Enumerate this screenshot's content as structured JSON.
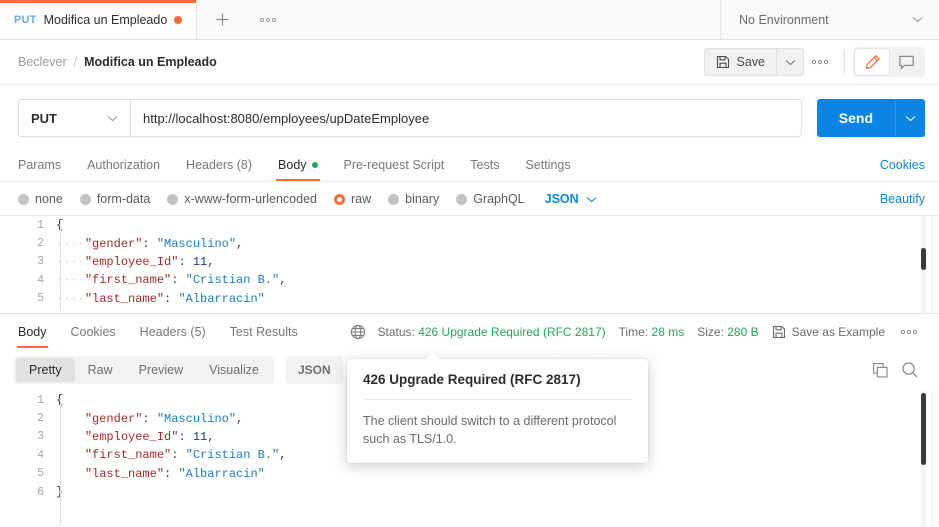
{
  "tabbar": {
    "request_tab": {
      "method": "PUT",
      "title": "Modifica un Empleado",
      "unsaved": true
    },
    "new_tab_label": "+",
    "more_label": "○○○",
    "environment": {
      "value": "No Environment"
    }
  },
  "header": {
    "breadcrumb_root": "Beclever",
    "breadcrumb_sep": "/",
    "breadcrumb_current": "Modifica un Empleado",
    "save_label": "Save",
    "more_label": "○○○"
  },
  "urlbar": {
    "method": "PUT",
    "url": "http://localhost:8080/employees/upDateEmployee",
    "send_label": "Send"
  },
  "request": {
    "tabs": [
      {
        "label": "Params",
        "active": false
      },
      {
        "label": "Authorization",
        "active": false
      },
      {
        "label": "Headers (8)",
        "active": false
      },
      {
        "label": "Body",
        "active": true,
        "dot": true
      },
      {
        "label": "Pre-request Script",
        "active": false
      },
      {
        "label": "Tests",
        "active": false
      },
      {
        "label": "Settings",
        "active": false
      }
    ],
    "cookies_link": "Cookies",
    "beautify_link": "Beautify",
    "body_types": [
      {
        "label": "none",
        "selected": false
      },
      {
        "label": "form-data",
        "selected": false
      },
      {
        "label": "x-www-form-urlencoded",
        "selected": false
      },
      {
        "label": "raw",
        "selected": true
      },
      {
        "label": "binary",
        "selected": false
      },
      {
        "label": "GraphQL",
        "selected": false
      }
    ],
    "raw_format": "JSON",
    "body_lines": [
      {
        "num": "1",
        "text": "{"
      },
      {
        "num": "2",
        "key": "\"gender\"",
        "value": "\"Masculino\"",
        "type": "string",
        "comma": true
      },
      {
        "num": "3",
        "key": "\"employee_Id\"",
        "value": "11",
        "type": "number",
        "comma": true
      },
      {
        "num": "4",
        "key": "\"first_name\"",
        "value": "\"Cristian B.\"",
        "type": "string",
        "comma": true
      },
      {
        "num": "5",
        "key": "\"last_name\"",
        "value": "\"Albarracin\"",
        "type": "string",
        "comma": false
      }
    ]
  },
  "response": {
    "tabs": [
      {
        "label": "Body",
        "active": true
      },
      {
        "label": "Cookies",
        "active": false
      },
      {
        "label": "Headers (5)",
        "active": false
      },
      {
        "label": "Test Results",
        "active": false
      }
    ],
    "status_prefix": "Status:",
    "status_value": "426 Upgrade Required (RFC 2817)",
    "time_prefix": "Time:",
    "time_value": "28 ms",
    "size_prefix": "Size:",
    "size_value": "280 B",
    "save_example_label": "Save as Example",
    "more_label": "○○○",
    "view_tabs": [
      {
        "label": "Pretty",
        "active": true
      },
      {
        "label": "Raw",
        "active": false
      },
      {
        "label": "Preview",
        "active": false
      },
      {
        "label": "Visualize",
        "active": false
      }
    ],
    "format": "JSON",
    "body_lines": [
      {
        "num": "1",
        "text": "{"
      },
      {
        "num": "2",
        "key": "\"gender\"",
        "value": "\"Masculino\"",
        "type": "string",
        "comma": true
      },
      {
        "num": "3",
        "key": "\"employee_Id\"",
        "value": "11",
        "type": "number",
        "comma": true
      },
      {
        "num": "4",
        "key": "\"first_name\"",
        "value": "\"Cristian B.\"",
        "type": "string",
        "comma": true
      },
      {
        "num": "5",
        "key": "\"last_name\"",
        "value": "\"Albarracin\"",
        "type": "string",
        "comma": false
      },
      {
        "num": "6",
        "text": "}"
      }
    ]
  },
  "tooltip": {
    "title": "426 Upgrade Required (RFC 2817)",
    "body": "The client should switch to a different protocol such as TLS/1.0."
  },
  "colors": {
    "accent_orange": "#ff6c37",
    "send_blue": "#0b84e3",
    "link_blue": "#0b84e3",
    "status_green": "#26a65b",
    "json_key": "#a52b2b",
    "json_string": "#1b7ec0",
    "json_number": "#1a3a8f"
  }
}
